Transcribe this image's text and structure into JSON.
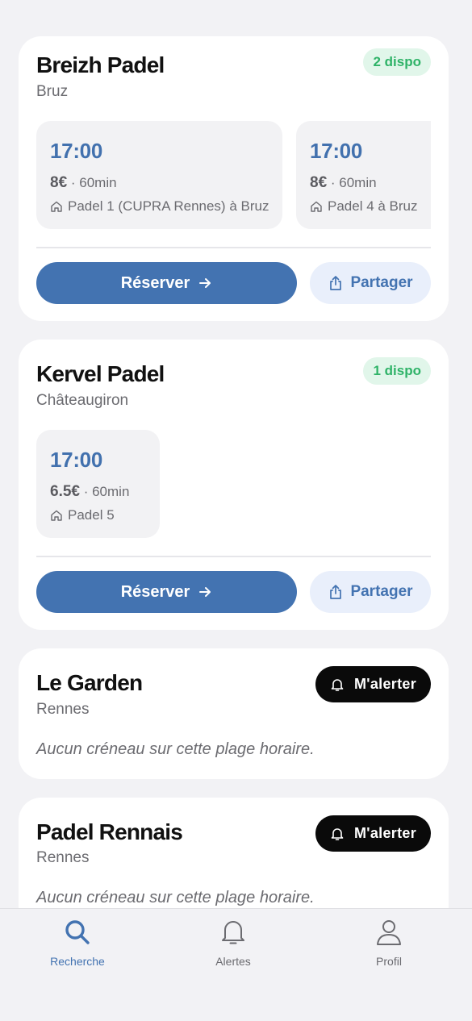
{
  "clubs": [
    {
      "name": "Breizh Padel",
      "city": "Bruz",
      "dispo": "2 dispo",
      "slots": [
        {
          "time": "17:00",
          "price": "8€",
          "duration": "· 60min",
          "court": "Padel 1 (CUPRA Rennes) à Bruz"
        },
        {
          "time": "17:00",
          "price": "8€",
          "duration": "· 60min",
          "court": "Padel 4 à Bruz"
        }
      ],
      "reserve_label": "Réserver",
      "share_label": "Partager"
    },
    {
      "name": "Kervel Padel",
      "city": "Châteaugiron",
      "dispo": "1 dispo",
      "slots": [
        {
          "time": "17:00",
          "price": "6.5€",
          "duration": "· 60min",
          "court": "Padel 5"
        }
      ],
      "reserve_label": "Réserver",
      "share_label": "Partager"
    },
    {
      "name": "Le Garden",
      "city": "Rennes",
      "alert_label": "M'alerter",
      "empty_message": "Aucun créneau sur cette plage horaire."
    },
    {
      "name": "Padel Rennais",
      "city": "Rennes",
      "alert_label": "M'alerter",
      "empty_message": "Aucun créneau sur cette plage horaire."
    }
  ],
  "tabbar": {
    "tabs": [
      {
        "label": "Recherche",
        "icon": "search-icon",
        "active": true
      },
      {
        "label": "Alertes",
        "icon": "bell-icon",
        "active": false
      },
      {
        "label": "Profil",
        "icon": "user-icon",
        "active": false
      }
    ]
  },
  "colors": {
    "accent": "#4373b1",
    "dispo_bg": "#e1f6ea",
    "dispo_text": "#2fb368",
    "alert_button": "#0a0a0a",
    "background": "#f2f2f5"
  }
}
